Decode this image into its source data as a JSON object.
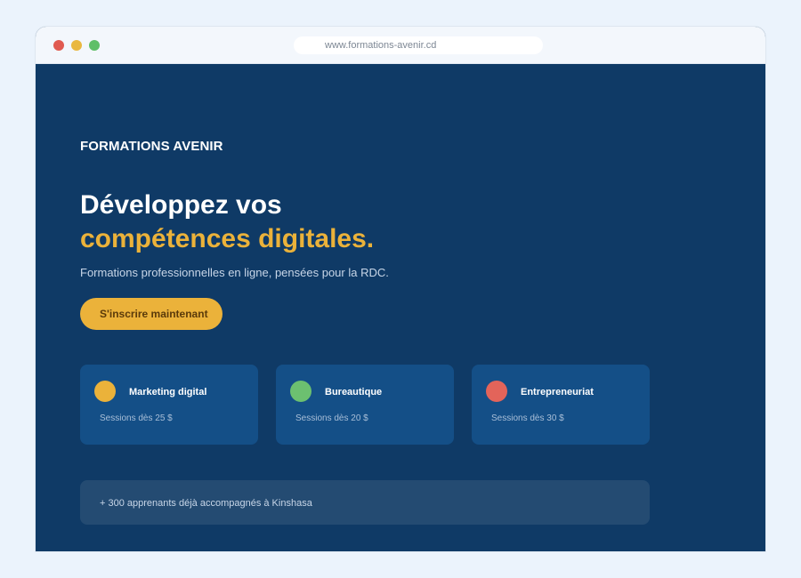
{
  "browser": {
    "url": "www.formations-avenir.cd",
    "dots": {
      "close": "#e05a50",
      "minimize": "#e9b840",
      "maximize": "#5fbf68"
    }
  },
  "brand": "FORMATIONS AVENIR",
  "hero": {
    "line1": "Développez vos",
    "line2": "compétences digitales.",
    "accent": "#ebb23a",
    "subtitle": "Formations professionnelles en ligne, pensées pour la RDC.",
    "cta": "S'inscrire maintenant"
  },
  "courses": [
    {
      "name": "Marketing digital",
      "price": "Sessions dès 25 $",
      "color": "#ebb23a"
    },
    {
      "name": "Bureautique",
      "price": "Sessions dès 20 $",
      "color": "#6cc070"
    },
    {
      "name": "Entrepreneuriat",
      "price": "Sessions dès 30 $",
      "color": "#e3645a"
    }
  ],
  "banner": "+ 300 apprenants déjà accompagnés à Kinshasa"
}
